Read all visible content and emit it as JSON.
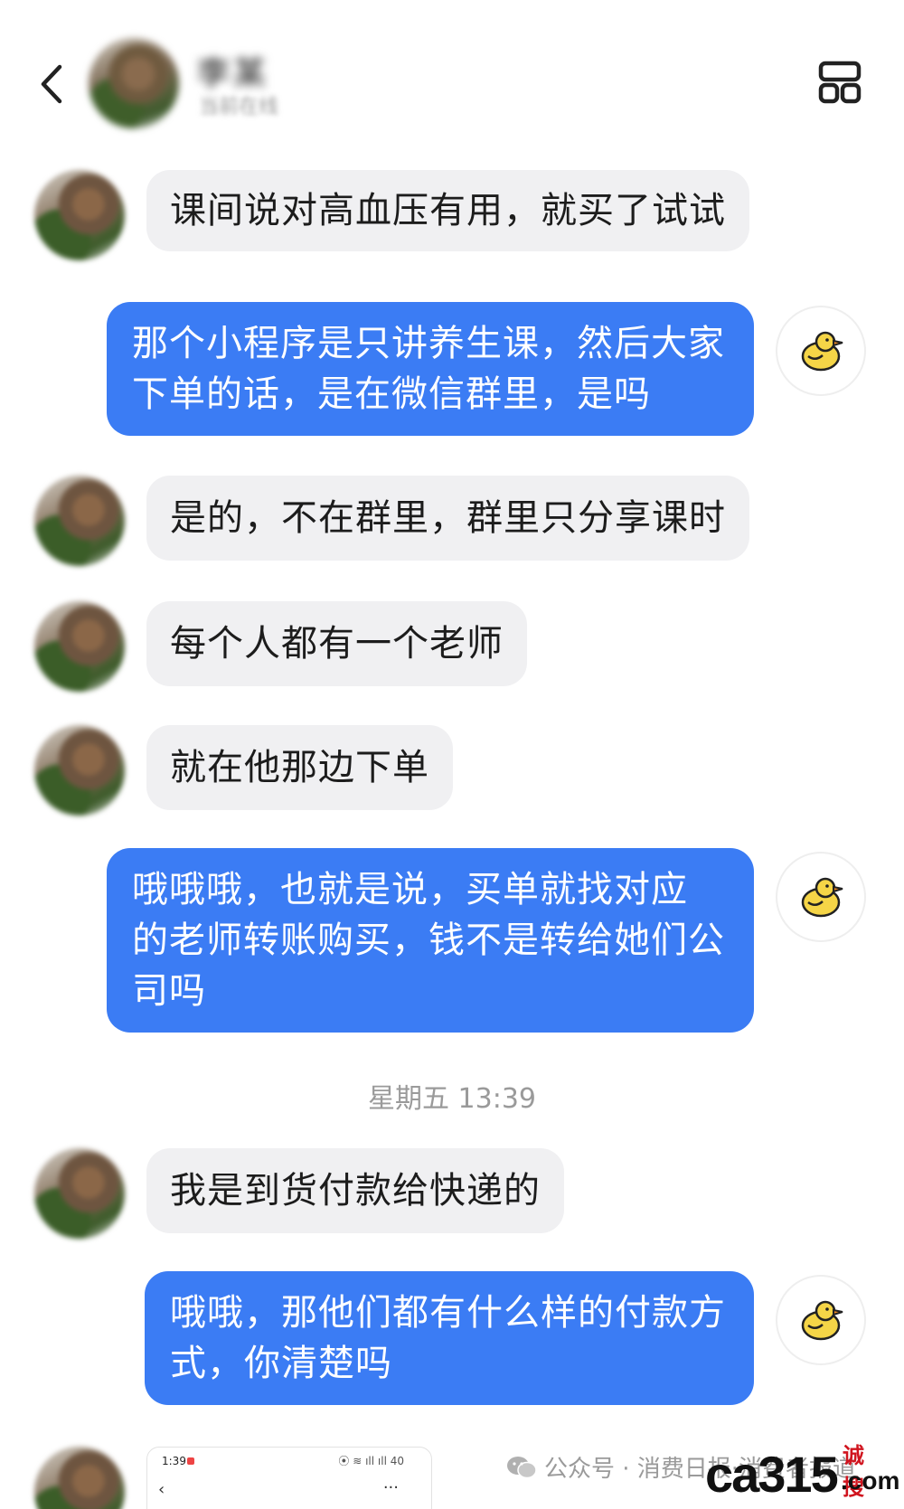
{
  "header": {
    "contact_name": "李某",
    "contact_status": "当前在线"
  },
  "messages": [
    {
      "side": "left",
      "text": "课间说对高血压有用，就买了试试"
    },
    {
      "side": "right",
      "lines": [
        "那个小程序是只讲养生课，然后大家",
        "下单的话，是在微信群里，是吗"
      ]
    },
    {
      "side": "left",
      "text": "是的，不在群里，群里只分享课时"
    },
    {
      "side": "left",
      "text": "每个人都有一个老师"
    },
    {
      "side": "left",
      "text": "就在他那边下单"
    },
    {
      "side": "right",
      "lines": [
        "哦哦哦，也就是说，买单就找对应",
        "的老师转账购买，钱不是转给她们公",
        "司吗"
      ]
    },
    {
      "side": "left",
      "text": "我是到货付款给快递的"
    },
    {
      "side": "right",
      "lines": [
        "哦哦，那他们都有什么样的付款方",
        "式，你清楚吗"
      ]
    }
  ],
  "timestamp": "星期五 13:39",
  "thumbnail": {
    "time": "1:39",
    "status": "⦿ ≋ ıll ıll 40",
    "back": "‹",
    "more": "···"
  },
  "watermark": {
    "text": "公众号 · 消费日报·消费者报道",
    "brand_main": "ca315",
    "brand_cn": "诚搜",
    "brand_domain": ".com"
  },
  "colors": {
    "self_bubble": "#3b7cf4",
    "other_bubble": "#f0f0f2",
    "timestamp": "#9a9a9a"
  },
  "icons": {
    "back": "chevron-left-icon",
    "more": "grid-layout-icon",
    "self_avatar": "yellow-duck-icon",
    "watermark": "wechat-icon"
  }
}
